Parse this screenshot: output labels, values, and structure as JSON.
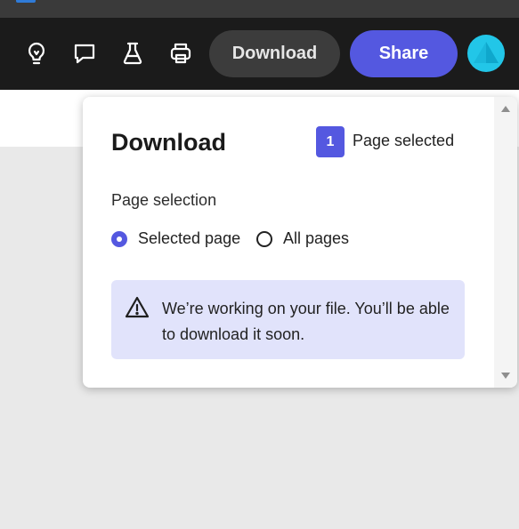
{
  "toolbar": {
    "icons": [
      "lightbulb-icon",
      "comment-icon",
      "flask-icon",
      "print-icon"
    ],
    "download_label": "Download",
    "share_label": "Share"
  },
  "panel": {
    "title": "Download",
    "selected_count": "1",
    "selected_label": "Page selected",
    "selection_heading": "Page selection",
    "options": [
      {
        "label": "Selected page",
        "selected": true
      },
      {
        "label": "All pages",
        "selected": false
      }
    ],
    "notice": {
      "icon": "warning-icon",
      "text": "We’re working on your file. You’ll be able to download it soon."
    }
  },
  "colors": {
    "accent": "#5458e0",
    "toolbar_bg": "#1b1b1b",
    "notice_bg": "#e1e3fb",
    "avatar": "#22c6e8"
  }
}
